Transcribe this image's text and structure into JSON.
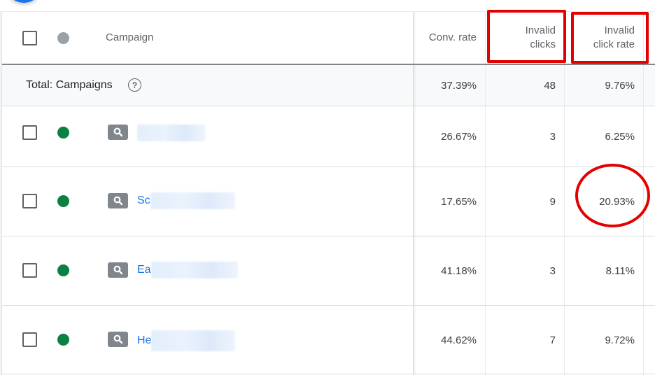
{
  "table": {
    "headers": {
      "campaign": "Campaign",
      "conv_rate": "Conv. rate",
      "invalid_clicks_line1": "Invalid",
      "invalid_clicks_line2": "clicks",
      "invalid_click_rate_line1": "Invalid",
      "invalid_click_rate_line2": "click rate"
    },
    "total": {
      "label": "Total: Campaigns",
      "help_icon": "?",
      "conv_rate": "37.39%",
      "invalid_clicks": "48",
      "invalid_click_rate": "9.76%"
    },
    "rows": [
      {
        "status": "enabled",
        "type_icon": "search-icon",
        "name_visible": "",
        "conv_rate": "26.67%",
        "invalid_clicks": "3",
        "invalid_click_rate": "6.25%"
      },
      {
        "status": "enabled",
        "type_icon": "search-icon",
        "name_visible": "Sc",
        "conv_rate": "17.65%",
        "invalid_clicks": "9",
        "invalid_click_rate": "20.93%"
      },
      {
        "status": "enabled",
        "type_icon": "search-icon",
        "name_visible": "Ea",
        "conv_rate": "41.18%",
        "invalid_clicks": "3",
        "invalid_click_rate": "8.11%"
      },
      {
        "status": "enabled",
        "type_icon": "search-icon",
        "name_visible": "He",
        "conv_rate": "44.62%",
        "invalid_clicks": "7",
        "invalid_click_rate": "9.72%"
      }
    ]
  },
  "colors": {
    "status_enabled": "#0b8043",
    "link": "#1a73e8",
    "annotation": "#e50000"
  },
  "annotations": {
    "highlighted_columns": [
      "Invalid clicks",
      "Invalid click rate"
    ],
    "circled_value": "20.93%"
  }
}
